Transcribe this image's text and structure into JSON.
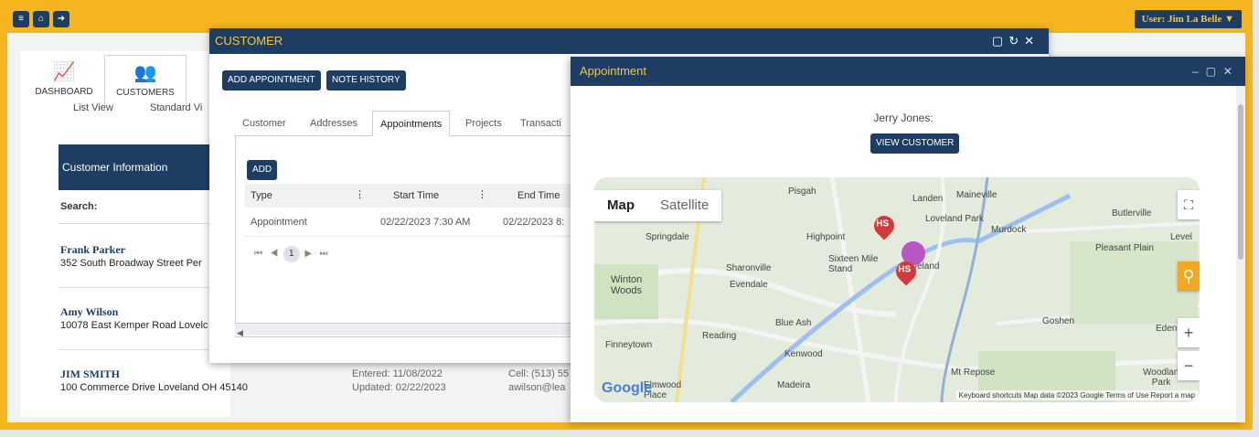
{
  "topbar": {
    "user_label": "User: Jim La Belle"
  },
  "nav": {
    "dashboard": "DASHBOARD",
    "customers": "CUSTOMERS"
  },
  "list": {
    "list_view": "List View",
    "standard_view": "Standard Vi",
    "info_header": "Customer Information",
    "search_label": "Search:",
    "customers": [
      {
        "name": "Frank Parker",
        "address": "352 South Broadway Street Per"
      },
      {
        "name": "Amy Wilson",
        "address": "10078 East Kemper Road Lovelc"
      },
      {
        "name": "JIM SMITH",
        "address": "100 Commerce Drive Loveland OH 45140",
        "entered": "Entered: 11/08/2022",
        "updated": "Updated: 02/22/2023",
        "cell": "Cell: (513) 55",
        "email": "awilson@lea"
      }
    ]
  },
  "customer_window": {
    "title": "CUSTOMER",
    "add_appointment": "ADD APPOINTMENT",
    "note_history": "NOTE HISTORY",
    "tabs": [
      "Customer",
      "Addresses",
      "Appointments",
      "Projects",
      "Transacti"
    ],
    "add": "ADD",
    "columns": [
      "Type",
      "Start Time",
      "End Time"
    ],
    "row": {
      "type": "Appointment",
      "start": "02/22/2023 7:30 AM",
      "end": "02/22/2023 8:"
    },
    "page": "1"
  },
  "appointment_window": {
    "title": "Appointment",
    "customer_name": "Jerry Jones:",
    "view_customer": "VIEW CUSTOMER",
    "map_toggle": [
      "Map",
      "Satellite"
    ],
    "places": [
      "Pisgah",
      "Landen",
      "Maineville",
      "Loveland Park",
      "Butlerville",
      "Springdale",
      "Highpoint",
      "Murdock",
      "Level",
      "Pleasant Plain",
      "Sharonville",
      "Sixteen Mile Stand",
      "veland",
      "Winton Woods",
      "Evendale",
      "Blue Ash",
      "Goshen",
      "Reading",
      "Finneytown",
      "Kenwood",
      "Mt Repose",
      "Woodland Park",
      "Elmwood Place",
      "Madeira",
      "Eden"
    ],
    "attribution": "Keyboard shortcuts   Map data ©2023 Google   Terms of Use   Report a map",
    "google": "Google",
    "pin_label": "HS"
  }
}
